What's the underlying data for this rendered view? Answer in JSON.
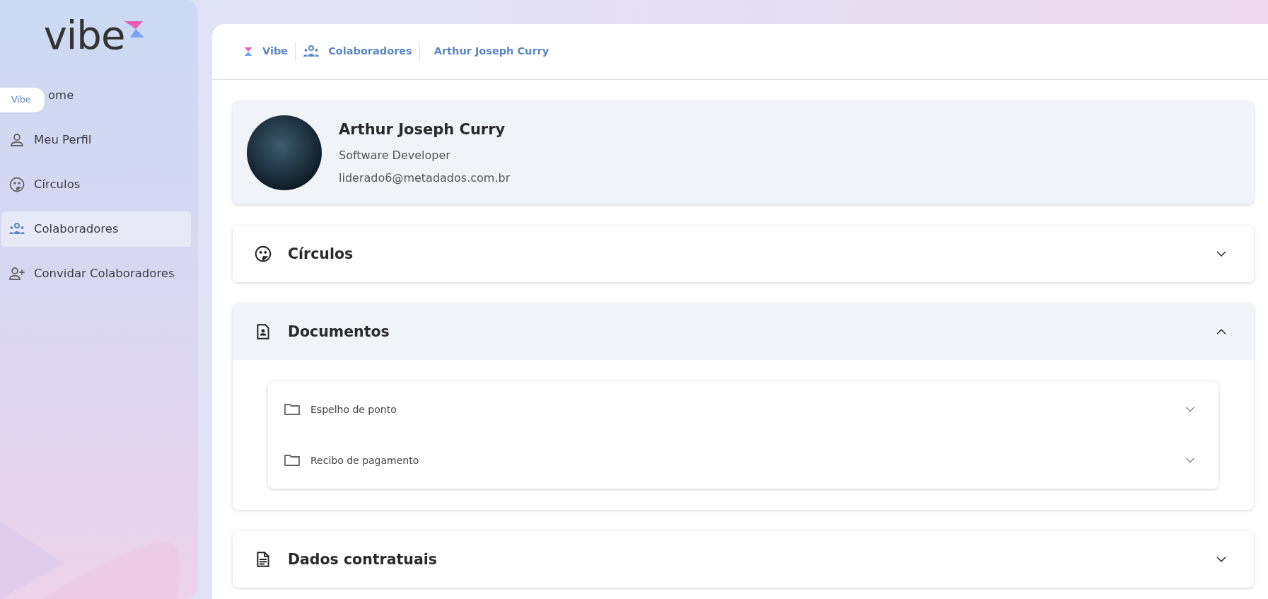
{
  "sidebar": {
    "logo": "vibe",
    "tooltip": "Vibe",
    "items": [
      {
        "label": "ome",
        "kind": "covered",
        "selected": false
      },
      {
        "label": "Meu Perfil",
        "kind": "person",
        "selected": false
      },
      {
        "label": "Círculos",
        "kind": "circles",
        "selected": false
      },
      {
        "label": "Colaboradores",
        "kind": "people",
        "selected": true
      },
      {
        "label": "Convidar Colaboradores",
        "kind": "person-add",
        "selected": false
      }
    ]
  },
  "breadcrumb": [
    {
      "label": "Vibe",
      "kind": "logo"
    },
    {
      "label": "Colaboradores",
      "kind": "people"
    },
    {
      "label": "Arthur Joseph Curry",
      "kind": "text"
    }
  ],
  "profile": {
    "name": "Arthur Joseph Curry",
    "role": "Software Developer",
    "email": "liderado6@metadados.com.br"
  },
  "sections": [
    {
      "title": "Círculos",
      "kind": "circles",
      "expanded": false
    },
    {
      "title": "Documentos",
      "kind": "document-person",
      "expanded": true,
      "folders": [
        {
          "label": "Espelho de ponto",
          "expanded": false
        },
        {
          "label": "Recibo de pagamento",
          "expanded": false
        }
      ]
    },
    {
      "title": "Dados contratuais",
      "kind": "document-lines",
      "expanded": false
    }
  ]
}
